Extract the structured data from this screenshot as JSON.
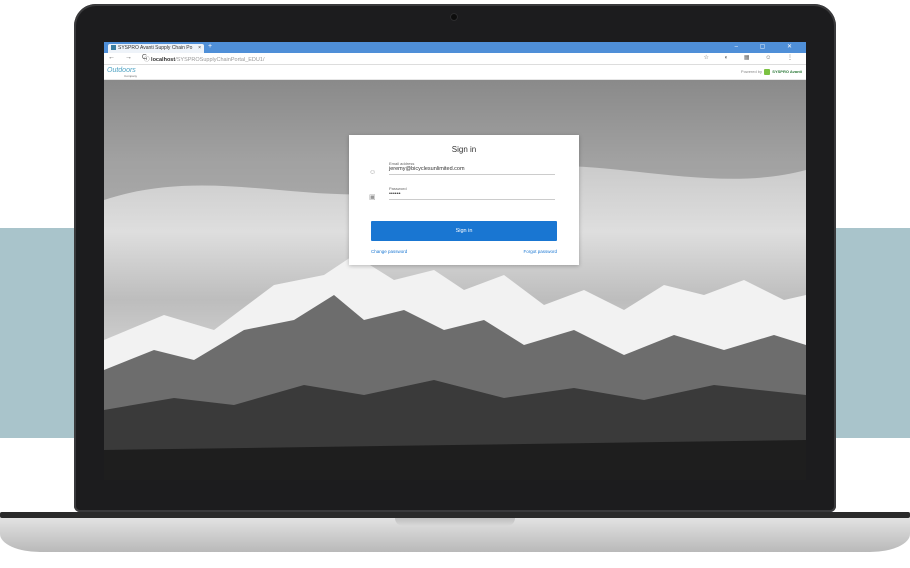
{
  "browser": {
    "tab_title": "SYSPRO Avanti Supply Chain Po",
    "tab_close": "×",
    "new_tab": "+",
    "url_host": "localhost",
    "url_path": "/SYSPROSupplyChainPortal_EDU1/",
    "nav_icons": "← → C",
    "info_icon": "ⓘ",
    "window_controls": "– ▢ ✕",
    "toolbar_icons": "☆ ◐ ▦ ☺ ⋮"
  },
  "header": {
    "logo_text": "Outdoors",
    "logo_sub": "Company",
    "powered_by": "Powered by",
    "brand": "SYSPRO Avanti"
  },
  "signin": {
    "title": "Sign in",
    "email_label": "Email address",
    "email_value": "jeremy@bicyclesunlimited.com",
    "password_label": "Password",
    "password_value": "••••••",
    "button_label": "Sign in",
    "change_password": "Change password",
    "forgot_password": "Forgot password"
  },
  "colors": {
    "accent": "#1976d2",
    "tab_bar": "#4f8fd8",
    "band": "#a9c4cb"
  }
}
